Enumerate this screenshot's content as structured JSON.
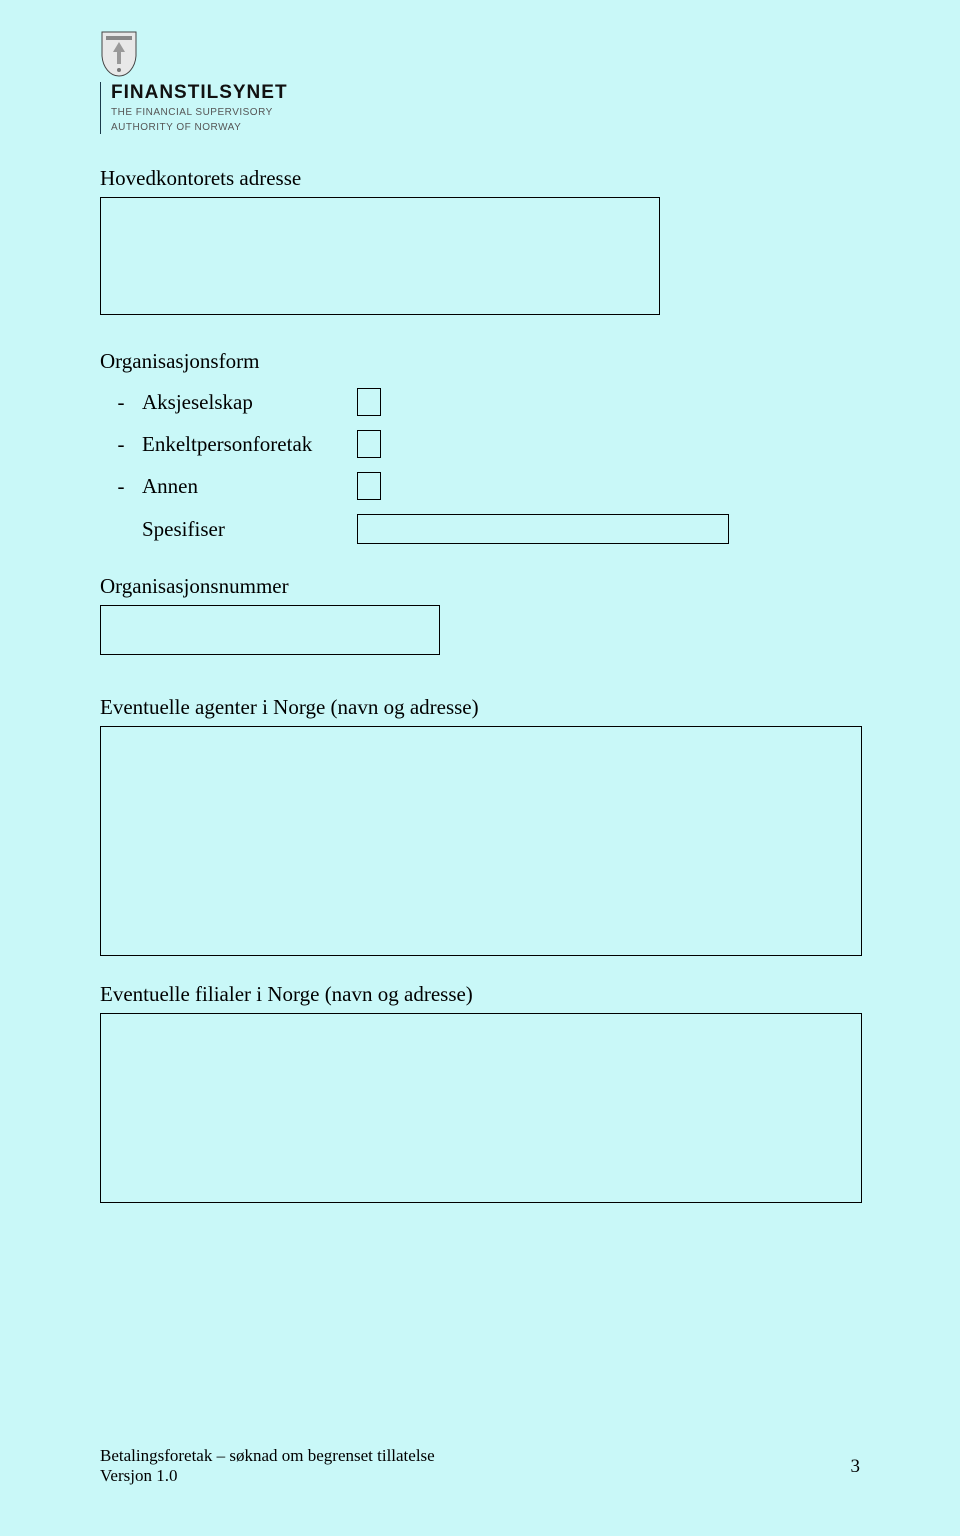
{
  "logo": {
    "name": "FINANSTILSYNET",
    "sub1": "THE FINANCIAL SUPERVISORY",
    "sub2": "AUTHORITY OF NORWAY"
  },
  "fields": {
    "address_label": "Hovedkontorets adresse",
    "orgform_label": "Organisasjonsform",
    "opts": {
      "dash": "-",
      "aksje": "Aksjeselskap",
      "enkelt": "Enkeltpersonforetak",
      "annen": "Annen"
    },
    "spesifiser": "Spesifiser",
    "orgnr_label": "Organisasjonsnummer",
    "agents_label": "Eventuelle agenter i Norge (navn og adresse)",
    "branches_label": "Eventuelle filialer i Norge (navn og adresse)"
  },
  "footer": {
    "line1": "Betalingsforetak – søknad om begrenset tillatelse",
    "line2": "Versjon 1.0",
    "page": "3"
  }
}
